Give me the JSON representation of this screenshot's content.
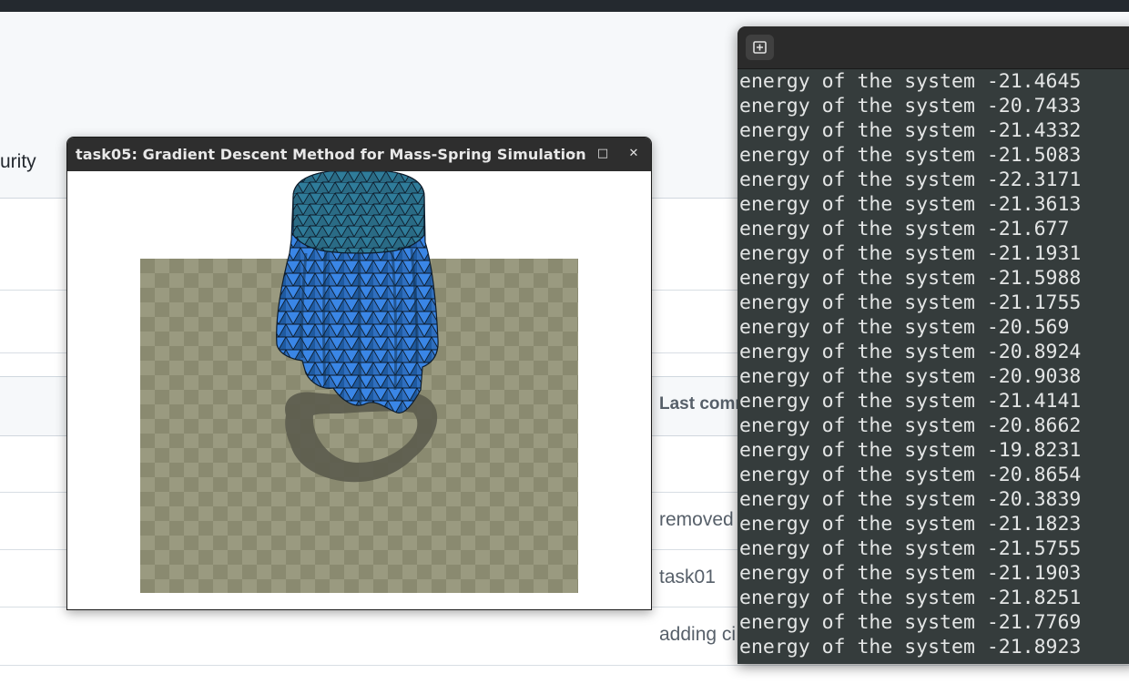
{
  "background_page": {
    "tab_partial": "urity",
    "table_header_partial": "Last commit message",
    "rows": [
      "removed empty",
      "task01",
      "adding ci"
    ]
  },
  "sim_window": {
    "title": "task05: Gradient Descent Method for Mass-Spring Simulation",
    "minimize_glyph": "–",
    "maximize_glyph": "□",
    "close_glyph": "✕",
    "floor_color_light": "#9a9a80",
    "floor_color_dark": "#8a8a70",
    "cloth_color": "#2f7fd8"
  },
  "terminal": {
    "new_tab_icon": "new-tab-icon",
    "lines": [
      "energy of the system -21.4645",
      "energy of the system -20.7433",
      "energy of the system -21.4332",
      "energy of the system -21.5083",
      "energy of the system -22.3171",
      "energy of the system -21.3613",
      "energy of the system -21.677",
      "energy of the system -21.1931",
      "energy of the system -21.5988",
      "energy of the system -21.1755",
      "energy of the system -20.569",
      "energy of the system -20.8924",
      "energy of the system -20.9038",
      "energy of the system -21.4141",
      "energy of the system -20.8662",
      "energy of the system -19.8231",
      "energy of the system -20.8654",
      "energy of the system -20.3839",
      "energy of the system -21.1823",
      "energy of the system -21.5755",
      "energy of the system -21.1903",
      "energy of the system -21.8251",
      "energy of the system -21.7769",
      "energy of the system -21.8923"
    ]
  }
}
